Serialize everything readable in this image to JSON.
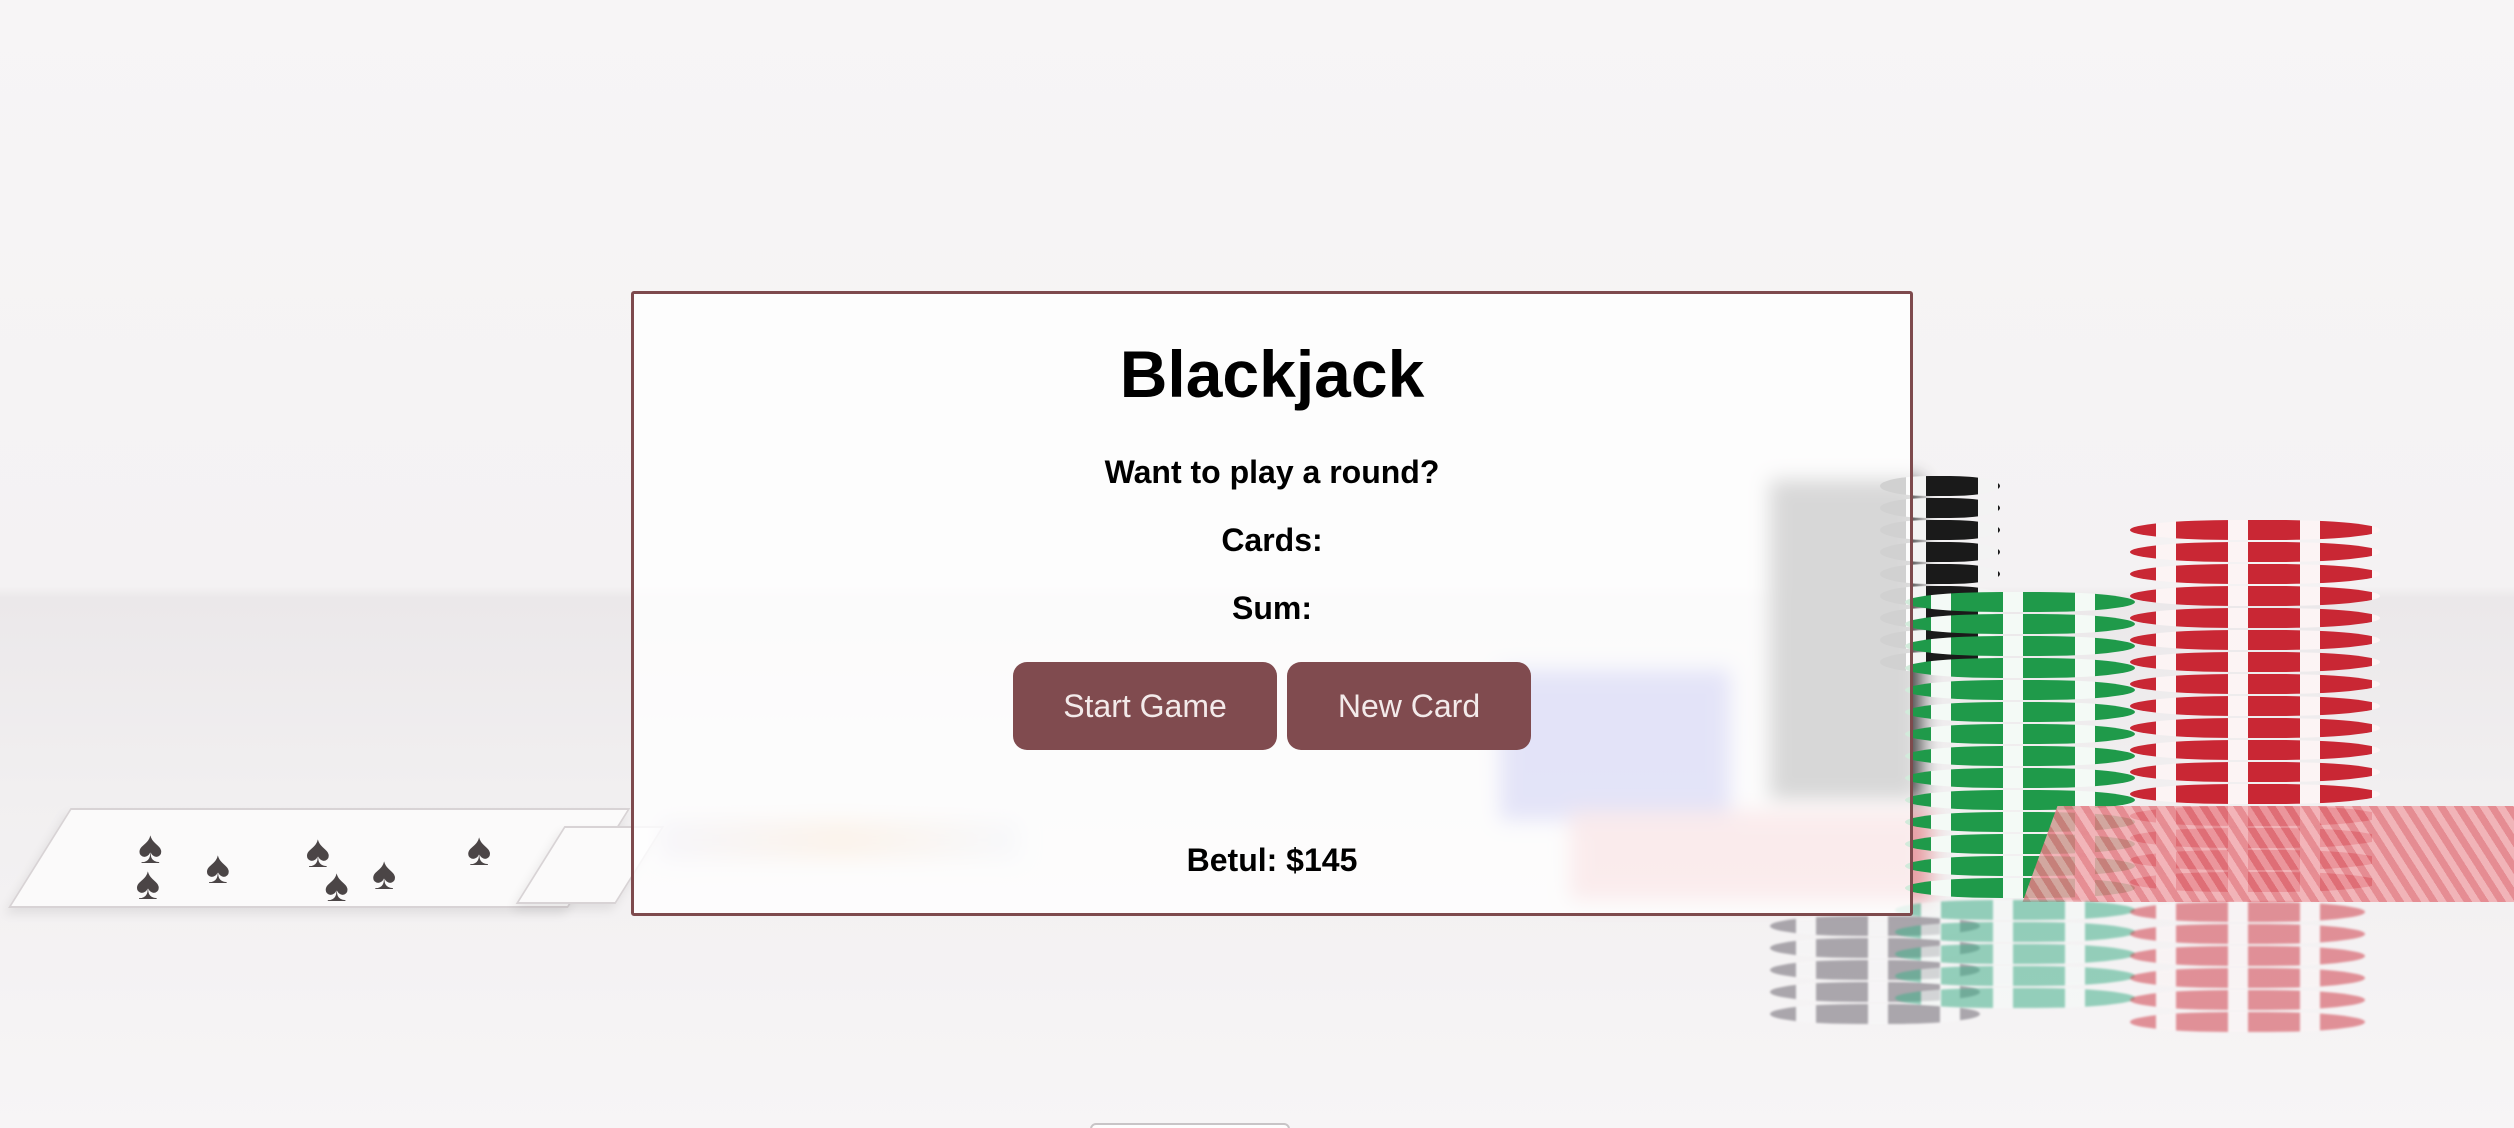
{
  "game": {
    "title": "Blackjack",
    "message": "Want to play a round?",
    "cards_label": "Cards:",
    "sum_label": "Sum:",
    "buttons": {
      "start": "Start Game",
      "new_card": "New Card"
    },
    "player": {
      "name": "Betul",
      "chips": "$145",
      "display": "Betul: $145"
    }
  },
  "theme": {
    "accent": "#804b4f",
    "border": "#7e4a4d",
    "button_text": "#f3eaea"
  },
  "background": {
    "description_icons": [
      "playing-card-icon",
      "poker-chip-stack-icon"
    ]
  }
}
